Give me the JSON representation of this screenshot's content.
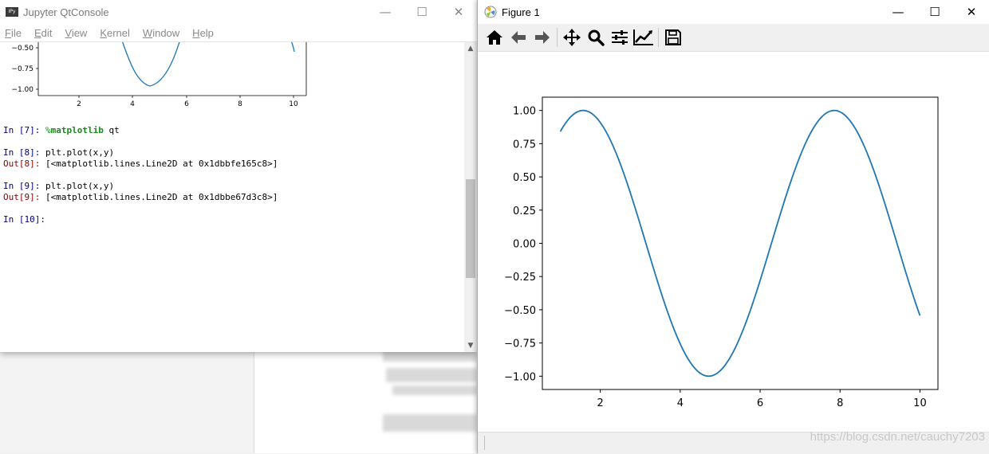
{
  "jupyter": {
    "title": "Jupyter QtConsole",
    "app_icon_text": "IPy",
    "menu": [
      "File",
      "Edit",
      "View",
      "Kernel",
      "Window",
      "Help"
    ],
    "inline_plot": {
      "ytick_labels": [
        "−0.50",
        "−0.75",
        "−1.00"
      ],
      "xtick_labels": [
        "2",
        "4",
        "6",
        "8",
        "10"
      ]
    },
    "cells": [
      {
        "prompt": "In [7]:",
        "code_prefix": "%",
        "code_magic": "matplotlib",
        "code_rest": " qt"
      },
      {
        "prompt": "In [8]:",
        "code": "plt.plot(x,y)",
        "out_prompt": "Out[8]:",
        "output": "[<matplotlib.lines.Line2D at 0x1dbbfe165c8>]"
      },
      {
        "prompt": "In [9]:",
        "code": "plt.plot(x,y)",
        "out_prompt": "Out[9]:",
        "output": "[<matplotlib.lines.Line2D at 0x1dbbe67d3c8>]"
      },
      {
        "prompt": "In [10]:",
        "code": ""
      }
    ]
  },
  "figure": {
    "title": "Figure 1",
    "toolbar": [
      {
        "name": "home-icon",
        "tip": "Home"
      },
      {
        "name": "back-icon",
        "tip": "Back"
      },
      {
        "name": "forward-icon",
        "tip": "Forward"
      },
      {
        "name": "pan-icon",
        "tip": "Pan"
      },
      {
        "name": "zoom-icon",
        "tip": "Zoom"
      },
      {
        "name": "subplots-icon",
        "tip": "Subplots"
      },
      {
        "name": "customize-icon",
        "tip": "Customize"
      },
      {
        "name": "save-icon",
        "tip": "Save"
      }
    ],
    "watermark": "https://blog.csdn.net/cauchy7203"
  },
  "chart_data": {
    "type": "line",
    "function": "y = sin(x)",
    "x_range": [
      1,
      10
    ],
    "series": [
      {
        "color": "#1f77b4",
        "x_start": 1,
        "x_end": 10,
        "samples": 200
      }
    ],
    "xlim": [
      0.55,
      10.45
    ],
    "ylim": [
      -1.1,
      1.1
    ],
    "xticks": [
      2,
      4,
      6,
      8,
      10
    ],
    "yticks": [
      1.0,
      0.75,
      0.5,
      0.25,
      0.0,
      -0.25,
      -0.5,
      -0.75,
      -1.0
    ],
    "ytick_labels": [
      "1.00",
      "0.75",
      "0.50",
      "0.25",
      "0.00",
      "−0.25",
      "−0.50",
      "−0.75",
      "−1.00"
    ],
    "xtick_labels": [
      "2",
      "4",
      "6",
      "8",
      "10"
    ],
    "xlabel": "",
    "ylabel": "",
    "title": "",
    "grid": false
  }
}
